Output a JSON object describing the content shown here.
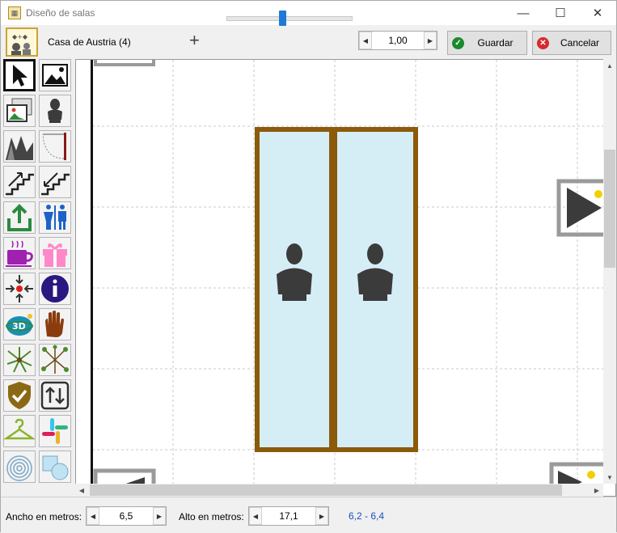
{
  "window": {
    "title": "Diseño de salas",
    "controls": {
      "minimize": "—",
      "maximize": "☐",
      "close": "✕"
    }
  },
  "toolbar": {
    "room_name": "Casa de Austria (4)",
    "zoom_plus": "+",
    "zoom_slider_fraction": 0.42,
    "zoom_value": "1,00",
    "save_label": "Guardar",
    "cancel_label": "Cancelar"
  },
  "palette": {
    "tools": [
      "select-arrow-icon",
      "image-icon",
      "images-icon",
      "bust-icon",
      "mountains-icon",
      "door-swing-icon",
      "stairs-up-icon",
      "stairs-down-icon",
      "exit-icon",
      "restroom-icon",
      "coffee-icon",
      "gift-icon",
      "assembly-point-icon",
      "info-icon",
      "3d-globe-icon",
      "hand-icon",
      "plant-icon",
      "tree-icon",
      "shield-check-icon",
      "swap-arrows-icon",
      "hanger-icon",
      "slack-icon",
      "radar-icon",
      "shapes-icon"
    ],
    "selected": "select-arrow-icon"
  },
  "statusbar": {
    "width_label": "Ancho en metros:",
    "width_value": "6,5",
    "height_label": "Alto en metros:",
    "height_value": "17,1",
    "range_text": "6,2 - 6,4"
  },
  "colors": {
    "vitrine_border": "#8b5a0b",
    "vitrine_fill": "#d5eef6",
    "bust": "#3b3b3b",
    "save_icon": "#1a8a2b",
    "cancel_icon": "#d62a2a",
    "accent_blue": "#1a4fbf"
  }
}
